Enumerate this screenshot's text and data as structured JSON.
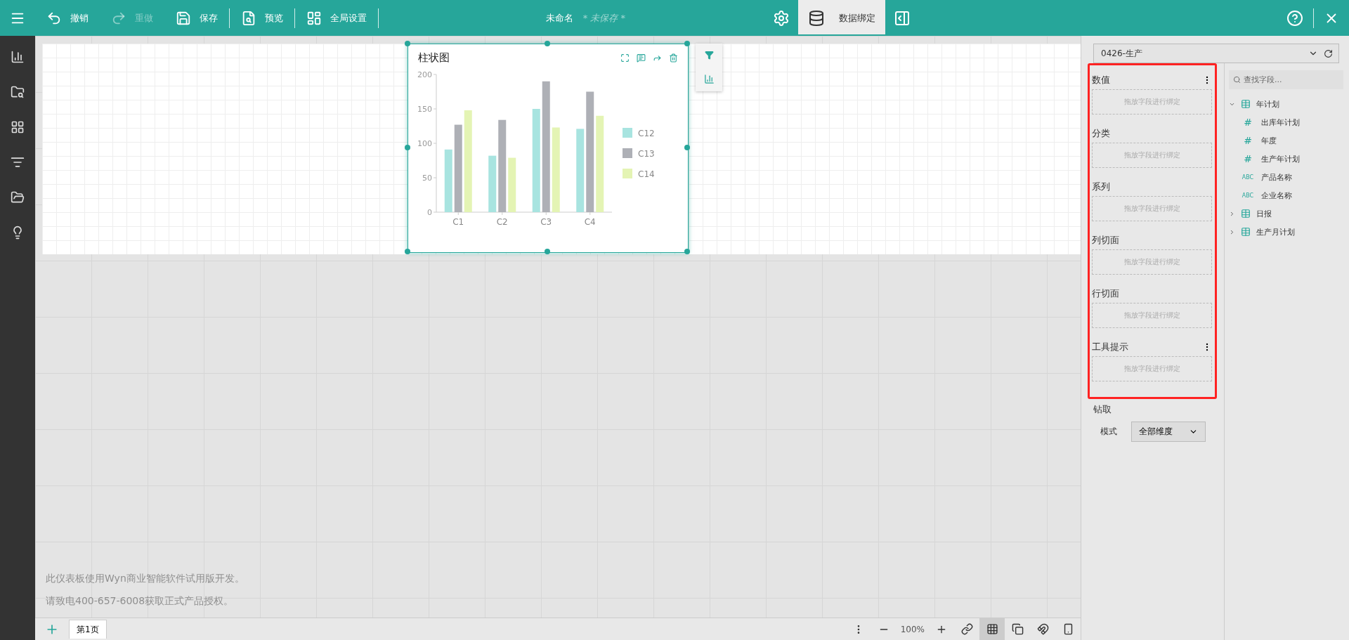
{
  "toolbar": {
    "actions": [
      {
        "kind": "undo",
        "label": "撤销",
        "disabled": false
      },
      {
        "kind": "redo",
        "label": "重做",
        "disabled": true
      },
      {
        "kind": "save",
        "label": "保存",
        "disabled": false
      },
      {
        "kind": "preview",
        "label": "预览",
        "disabled": false
      },
      {
        "kind": "layout",
        "label": "全局设置",
        "disabled": false
      }
    ],
    "title": "未命名",
    "status": "* 未保存 *",
    "right_tabs": [
      {
        "kind": "settings",
        "selected": false
      },
      {
        "kind": "data",
        "label": "数据绑定",
        "selected": true
      },
      {
        "kind": "panel",
        "selected": false
      }
    ]
  },
  "chart_card": {
    "title": "柱状图",
    "selected": true,
    "chart_data": {
      "type": "bar",
      "legend": "right",
      "categories": [
        "C1",
        "C2",
        "C3",
        "C4"
      ],
      "ylim": [
        0,
        200
      ],
      "yticks": [
        0,
        50,
        100,
        150,
        200
      ],
      "series": [
        {
          "name": "C12",
          "color": "#a8e4e0",
          "values": [
            91,
            82,
            150,
            121
          ]
        },
        {
          "name": "C13",
          "color": "#aeb0b6",
          "values": [
            127,
            134,
            190,
            175
          ]
        },
        {
          "name": "C14",
          "color": "#e4f4b4",
          "values": [
            148,
            79,
            123,
            140
          ]
        }
      ]
    }
  },
  "notice": [
    "此仪表板使用Wyn商业智能软件试用版开发。",
    "请致电400-657-6008获取正式产品授权。"
  ],
  "pages": [
    {
      "label": "第1页",
      "selected": true
    }
  ],
  "zoom": "100%",
  "view_tools": [
    {
      "kind": "link",
      "selected": false
    },
    {
      "kind": "grid",
      "selected": true
    },
    {
      "kind": "layers",
      "selected": false
    },
    {
      "kind": "magnet",
      "selected": false
    },
    {
      "kind": "mobile",
      "selected": false
    }
  ],
  "dataset": "0426-生产",
  "bindings": {
    "highlighted": true,
    "sections": [
      {
        "title": "数值",
        "more": true,
        "placeholder": "拖放字段进行绑定"
      },
      {
        "title": "分类",
        "more": false,
        "placeholder": "拖放字段进行绑定"
      },
      {
        "title": "系列",
        "more": false,
        "placeholder": "拖放字段进行绑定"
      },
      {
        "title": "列切面",
        "more": false,
        "placeholder": "拖放字段进行绑定"
      },
      {
        "title": "行切面",
        "more": false,
        "placeholder": "拖放字段进行绑定"
      },
      {
        "title": "工具提示",
        "more": true,
        "placeholder": "拖放字段进行绑定"
      }
    ]
  },
  "drill": {
    "title": "钻取",
    "mode_label": "模式",
    "mode": "全部维度"
  },
  "fields": {
    "search_placeholder": "查找字段...",
    "tree": [
      {
        "kind": "table",
        "label": "年计划",
        "expanded": true,
        "children": [
          {
            "kind": "number",
            "badge": "#",
            "label": "出库年计划"
          },
          {
            "kind": "number",
            "badge": "#",
            "label": "年度"
          },
          {
            "kind": "number",
            "badge": "#",
            "label": "生产年计划"
          },
          {
            "kind": "text",
            "badge": "ABC",
            "label": "产品名称"
          },
          {
            "kind": "text",
            "badge": "ABC",
            "label": "企业名称"
          }
        ]
      },
      {
        "kind": "table",
        "label": "日报",
        "expanded": false
      },
      {
        "kind": "table",
        "label": "生产月计划",
        "expanded": false
      }
    ]
  }
}
